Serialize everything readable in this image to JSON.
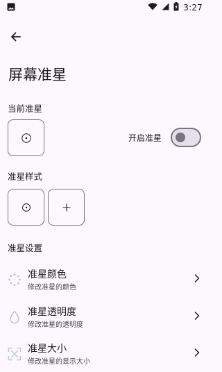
{
  "status_bar": {
    "time": "3:27",
    "icons": [
      "image-icon",
      "wifi-icon",
      "signal-icon",
      "battery-charging-icon"
    ]
  },
  "header": {
    "back_icon": "arrow-left-icon",
    "title": "屏幕准星"
  },
  "current_crosshair": {
    "section_label": "当前准星",
    "crosshair_style": "dot-circle",
    "toggle_label": "开启准星",
    "toggle_on": false
  },
  "crosshair_styles": {
    "section_label": "准星样式",
    "options": [
      {
        "style": "dot-circle",
        "icon": "dot-circle-icon"
      },
      {
        "style": "plus",
        "icon": "plus-icon"
      }
    ]
  },
  "settings": {
    "section_label": "准星设置",
    "items": [
      {
        "title": "准星颜色",
        "subtitle": "修改准星的颜色",
        "icon": "color-dots-icon"
      },
      {
        "title": "准星透明度",
        "subtitle": "修改准星的透明度",
        "icon": "water-drop-icon"
      },
      {
        "title": "准星大小",
        "subtitle": "修改准星的显示大小",
        "icon": "resize-icon"
      }
    ]
  },
  "colors": {
    "background": "#fdf8fd",
    "outline": "#79747e",
    "accent_icon": "#b9c7e8",
    "text": "#1c1b1f"
  }
}
